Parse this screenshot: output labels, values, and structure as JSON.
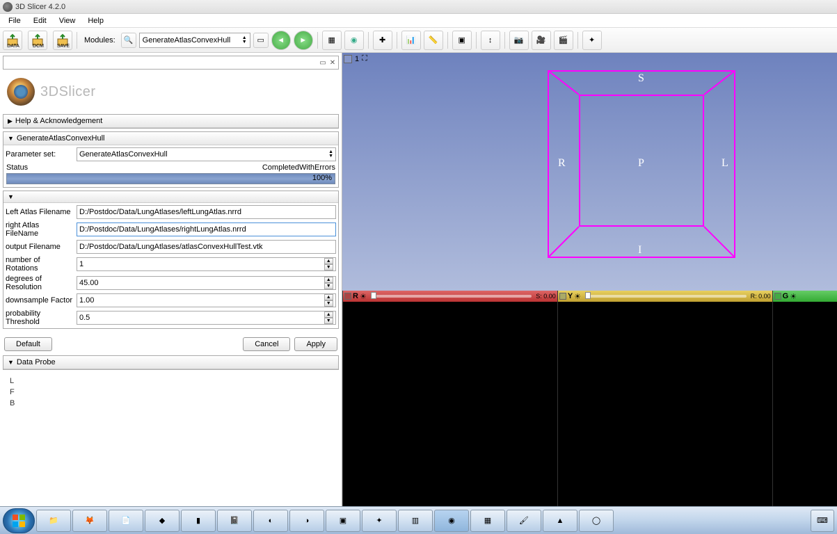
{
  "window": {
    "title": "3D Slicer 4.2.0"
  },
  "menu": {
    "file": "File",
    "edit": "Edit",
    "view": "View",
    "help": "Help"
  },
  "toolbar": {
    "data": "DATA",
    "dcm": "DCM",
    "save": "SAVE",
    "modules_label": "Modules:",
    "module_selected": "GenerateAtlasConvexHull"
  },
  "logo": "3DSlicer",
  "panels": {
    "help": "Help & Acknowledgement",
    "module": "GenerateAtlasConvexHull",
    "paramset_label": "Parameter set:",
    "paramset_value": "GenerateAtlasConvexHull",
    "status_label": "Status",
    "status_value": "CompletedWithErrors",
    "progress": "100%"
  },
  "fields": {
    "left_atlas_label": "Left Atlas Filename",
    "left_atlas_value": "D:/Postdoc/Data/LungAtlases/leftLungAtlas.nrrd",
    "right_atlas_label": "right Atlas FileName",
    "right_atlas_value": "D:/Postdoc/Data/LungAtlases/rightLungAtlas.nrrd",
    "output_label": "output Filename",
    "output_value": "D:/Postdoc/Data/LungAtlases/atlasConvexHullTest.vtk",
    "rotations_label": "number of Rotations",
    "rotations_value": "1",
    "degrees_label": "degrees of Resolution",
    "degrees_value": "45.00",
    "downsample_label": "downsample Factor",
    "downsample_value": "1.00",
    "prob_label": "probability Threshold",
    "prob_value": "0.5"
  },
  "buttons": {
    "default": "Default",
    "cancel": "Cancel",
    "apply": "Apply"
  },
  "dataprobe": {
    "title": "Data Probe",
    "L": "L",
    "F": "F",
    "B": "B"
  },
  "view3d": {
    "num": "1",
    "S": "S",
    "I": "I",
    "R": "R",
    "L": "L",
    "P": "P"
  },
  "slices": {
    "red_letter": "R",
    "red_val": "S: 0.00",
    "yellow_letter": "Y",
    "yellow_val": "R: 0.00",
    "green_letter": "G"
  }
}
